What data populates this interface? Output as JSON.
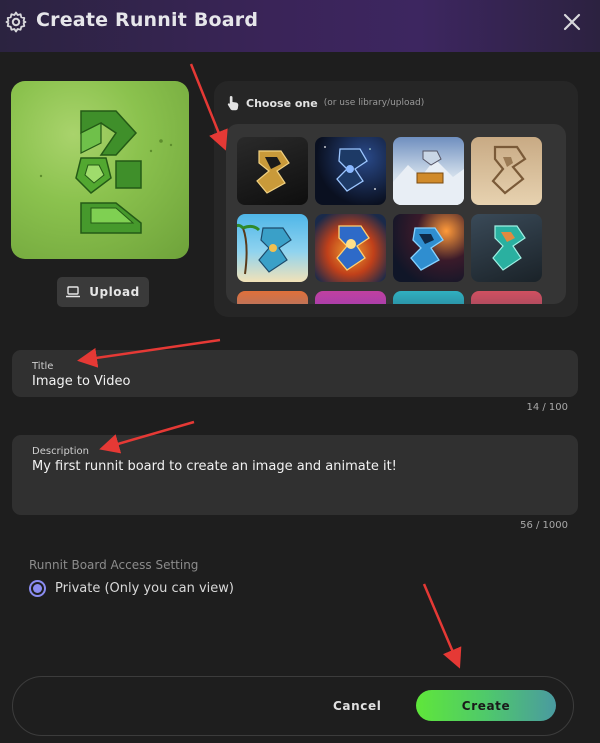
{
  "header": {
    "title": "Create Runnit Board",
    "settings_icon": "gear-icon",
    "close_icon": "close-icon"
  },
  "image_panel": {
    "upload_label": "Upload",
    "upload_icon": "laptop-icon"
  },
  "chooser": {
    "label": "Choose one",
    "sublabel": "(or use library/upload)",
    "icon": "pointing-hand-icon",
    "thumbnails": [
      {
        "name": "thumb-gold-dark"
      },
      {
        "name": "thumb-space"
      },
      {
        "name": "thumb-snow-mountain"
      },
      {
        "name": "thumb-sand"
      },
      {
        "name": "thumb-tropical-beach"
      },
      {
        "name": "thumb-fire-splash"
      },
      {
        "name": "thumb-blue-fire"
      },
      {
        "name": "thumb-teal-glass"
      },
      {
        "name": "thumb-partial-1"
      },
      {
        "name": "thumb-partial-2"
      },
      {
        "name": "thumb-partial-3"
      },
      {
        "name": "thumb-partial-4"
      }
    ]
  },
  "title_field": {
    "label": "Title",
    "value": "Image to Video",
    "counter": "14 / 100"
  },
  "description_field": {
    "label": "Description",
    "value": "My first runnit board to create an image and animate it!",
    "counter": "56 / 1000"
  },
  "access": {
    "label": "Runnit Board Access Setting",
    "option": "Private (Only you can view)",
    "selected": true
  },
  "footer": {
    "cancel_label": "Cancel",
    "create_label": "Create"
  },
  "colors": {
    "accent_radio": "#8a8cf0",
    "create_gradient_start": "#5fe63a",
    "create_gradient_end": "#4a9aa0",
    "annotation_arrow": "#e53935"
  }
}
